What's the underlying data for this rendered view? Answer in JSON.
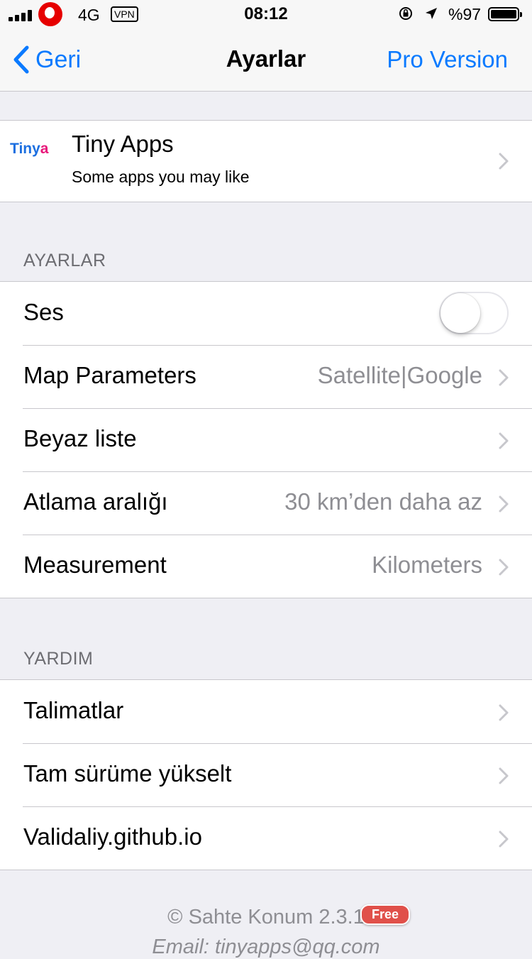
{
  "status_bar": {
    "network": "4G",
    "vpn": "VPN",
    "time": "08:12",
    "battery_percent": "%97",
    "battery_level": 0.97,
    "signal_bars": 4
  },
  "nav": {
    "back_label": "Geri",
    "title": "Ayarlar",
    "right_action": "Pro Version",
    "accent_color": "#0a7aff"
  },
  "promo": {
    "logo_main": "Tiny",
    "logo_accent": "a",
    "title": "Tiny Apps",
    "subtitle": "Some apps you may like"
  },
  "settings_section": {
    "header": "AYARLAR",
    "sound": {
      "label": "Ses",
      "enabled": false
    },
    "rows": [
      {
        "label": "Map Parameters",
        "value": "Satellite|Google"
      },
      {
        "label": "Beyaz liste",
        "value": ""
      },
      {
        "label": "Atlama aralığı",
        "value": "30 km’den daha az"
      },
      {
        "label": "Measurement",
        "value": "Kilometers"
      }
    ]
  },
  "help_section": {
    "header": "YARDIM",
    "rows": [
      {
        "label": "Talimatlar"
      },
      {
        "label": "Tam sürüme yükselt"
      },
      {
        "label": "Validaliy.github.io"
      }
    ]
  },
  "footer": {
    "copyright": "© Sahte Konum 2.3.1",
    "badge": "Free",
    "email": "Email: tinyapps@qq.com"
  }
}
